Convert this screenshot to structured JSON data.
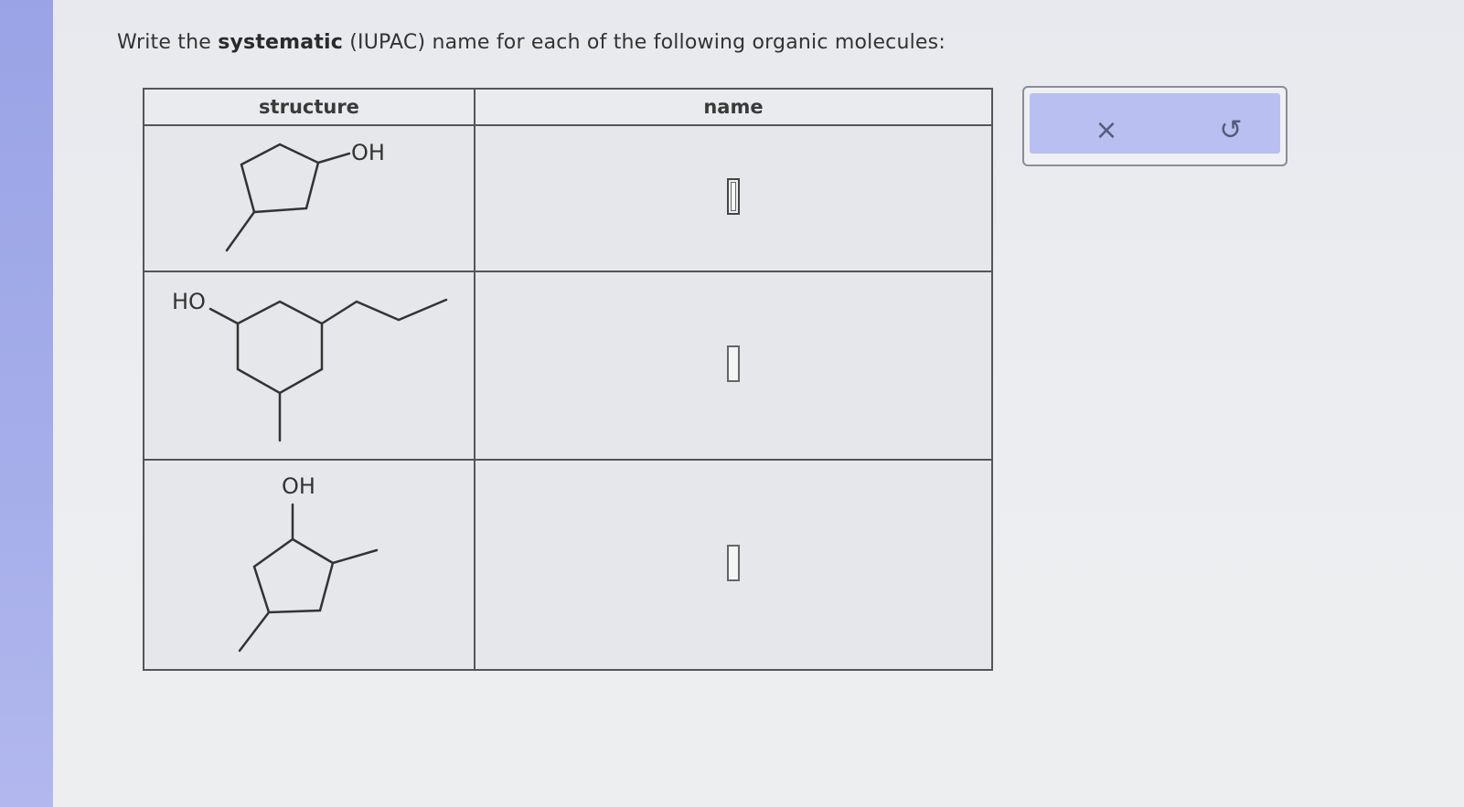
{
  "prompt": {
    "before": "Write the ",
    "bold": "systematic",
    "after": " (IUPAC) name for each of the following organic molecules:"
  },
  "table": {
    "headers": {
      "structure": "structure",
      "name": "name"
    },
    "rows": [
      {
        "labels": [
          "OH"
        ],
        "answer": ""
      },
      {
        "labels": [
          "HO"
        ],
        "answer": ""
      },
      {
        "labels": [
          "OH"
        ],
        "answer": ""
      }
    ]
  },
  "tools": {
    "clear": "×",
    "undo": "↺"
  },
  "colors": {
    "accent": "#b9bff0",
    "sidebar": "#9aa3e6"
  }
}
